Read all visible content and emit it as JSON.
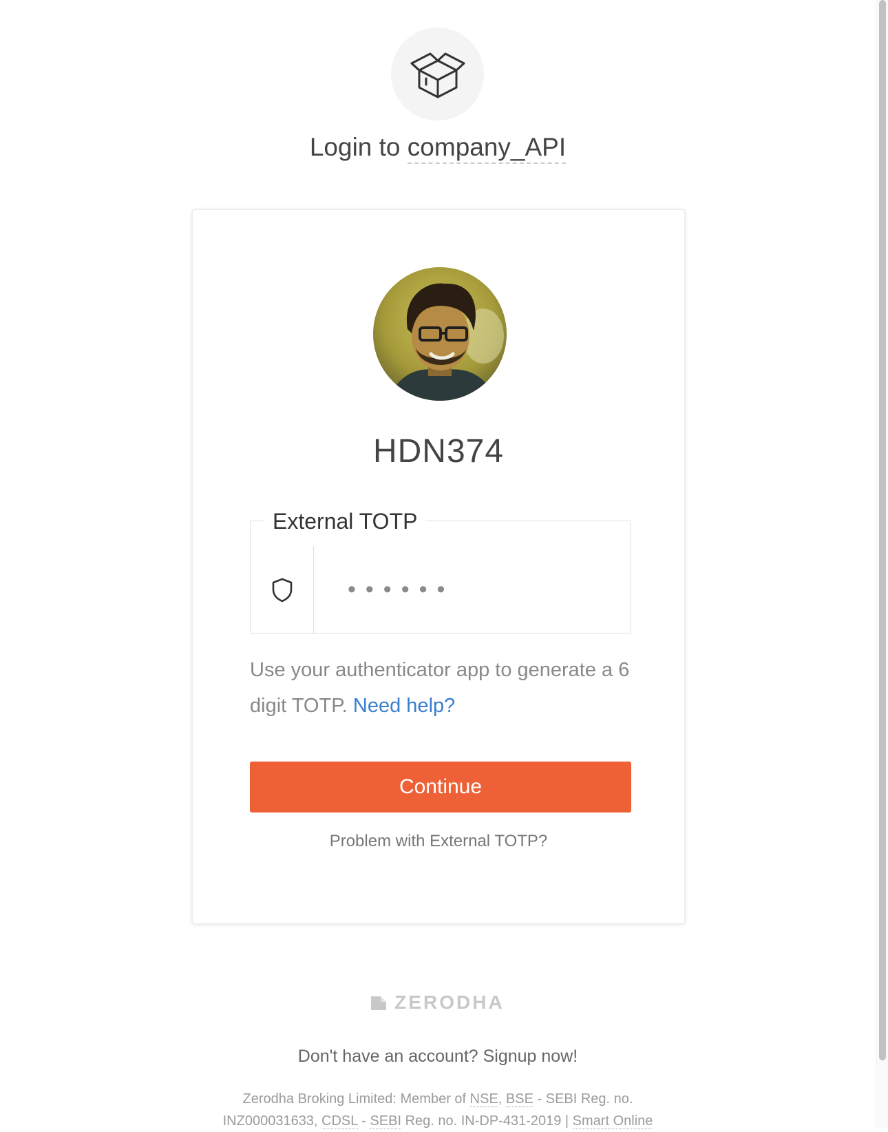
{
  "app": {
    "title_prefix": "Login to",
    "app_name": "company_API",
    "logo_icon": "open-box-icon"
  },
  "login_card": {
    "user_id": "HDN374",
    "avatar_icon": "user-avatar",
    "totp": {
      "label": "External TOTP",
      "icon": "shield-icon",
      "value": "",
      "placeholder": "••••••"
    },
    "help": {
      "text": "Use your authenticator app to generate a 6 digit TOTP.",
      "link_label": "Need help?"
    },
    "continue_label": "Continue",
    "problem_label": "Problem with External TOTP?"
  },
  "footer": {
    "brand": "ZERODHA",
    "signup": "Don't have an account? Signup now!",
    "legal": {
      "part1": "Zerodha Broking Limited: Member of ",
      "nse": "NSE",
      "sep1": ", ",
      "bse": "BSE",
      "part2": " - SEBI Reg. no. INZ000031633, ",
      "cdsl": "CDSL",
      "sep2": " - ",
      "sebi": "SEBI",
      "part3": " Reg. no. IN-DP-431-2019 | ",
      "smart_online": "Smart Online"
    }
  },
  "colors": {
    "accent": "#ee6136",
    "link": "#387ed1"
  }
}
